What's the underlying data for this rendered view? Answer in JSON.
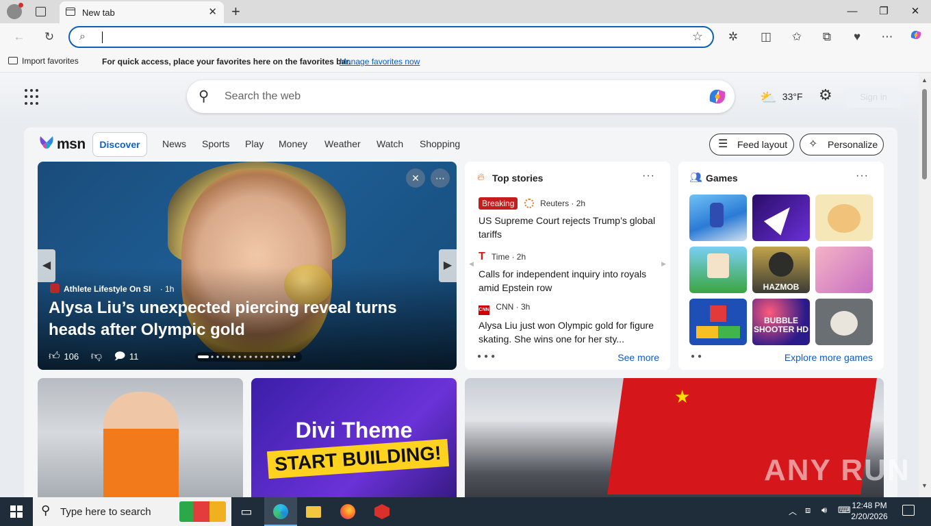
{
  "browser": {
    "tab_title": "New tab",
    "address_value": "",
    "favorites_bar": {
      "import_label": "Import favorites",
      "message": "For quick access, place your favorites here on the favorites bar.",
      "manage_link": "Manage favorites now"
    }
  },
  "newtab": {
    "search_placeholder": "Search the web",
    "weather_temp": "33°F",
    "signin_label": "Sign in"
  },
  "msn": {
    "logo_text": "msn",
    "nav": [
      "Discover",
      "News",
      "Sports",
      "Play",
      "Money",
      "Weather",
      "Watch",
      "Shopping"
    ],
    "feed_layout_label": "Feed layout",
    "personalize_label": "Personalize"
  },
  "hero": {
    "source": "Athlete Lifestyle On SI",
    "age": "· 1h",
    "headline": "Alysa Liu’s unexpected piercing reveal turns heads after Olympic gold",
    "likes": "106",
    "comments": "11"
  },
  "top_stories": {
    "title": "Top stories",
    "items": [
      {
        "badge": "Breaking",
        "source": "Reuters · 2h",
        "headline": "US Supreme Court rejects Trump’s global tariffs"
      },
      {
        "badge": "",
        "source": "Time · 2h",
        "headline": "Calls for independent inquiry into royals amid Epstein row"
      },
      {
        "badge": "",
        "source": "CNN · 3h",
        "headline": "Alysa Liu just won Olympic gold for figure skating. She wins one for her sty..."
      }
    ],
    "see_more": "See more"
  },
  "games": {
    "title": "Games",
    "explore": "Explore more games",
    "tile_labels": [
      "HAZMOB",
      "BUBBLE SHOOTER HD"
    ]
  },
  "promo": {
    "line1": "Divi Theme",
    "line2": "START BUILDING!"
  },
  "watermark": "ANY RUN",
  "taskbar": {
    "search_placeholder": "Type here to search",
    "time": "12:48 PM",
    "date": "2/20/2026"
  },
  "colors": {
    "accent": "#0c5fb8",
    "link": "#0a5bc4",
    "breaking": "#c51d1d",
    "taskbar": "#1f2c3a"
  }
}
